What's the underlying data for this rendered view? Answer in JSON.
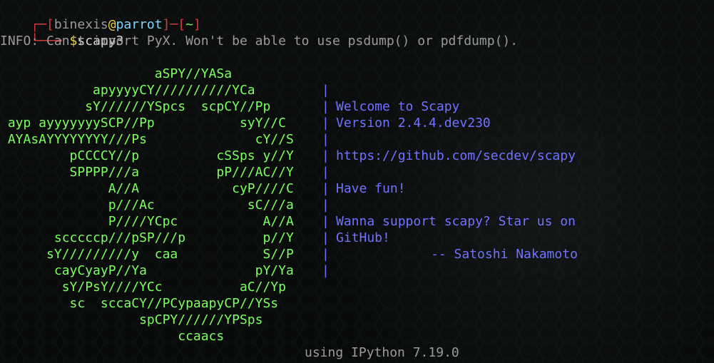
{
  "terminal": {
    "prompt": {
      "user": "binexis",
      "at": "@",
      "host": "parrot",
      "dir": "~"
    },
    "command": {
      "symbol": "$",
      "text": "scapy3"
    },
    "info": "INFO: Can't import PyX. Won't be able to use psdump() or pdfdump().",
    "art_lines": [
      "                    aSPY//YASa",
      "            apyyyyCY//////////YCa",
      "           sY//////YSpcs  scpCY//Pp",
      " ayp ayyyyyyySCP//Pp           syY//C",
      " AYAsAYYYYYYYY///Ps              cY//S",
      "         pCCCCY//p          cSSps y//Y",
      "         SPPPP///a          pP///AC//Y",
      "              A//A            cyP////C",
      "              p///Ac            sC///a",
      "              P////YCpc           A//A",
      "       scccccp///pSP///p          p//Y",
      "      sY/////////y  caa           S//P",
      "       cayCyayP//Ya              pY/Ya",
      "        sY/PsY////YCc          aC//Yp",
      "         sc  sccaCY//PCypaapyCP//YSs",
      "                  spCPY//////YPSps",
      "                       ccaacs"
    ],
    "bars": [
      "|",
      "|",
      "|",
      "|",
      "|",
      "|",
      "|",
      "|",
      "|",
      "|",
      "|",
      "|"
    ],
    "scapy_info": {
      "welcome": "Welcome to Scapy",
      "version": "Version 2.4.4.dev230",
      "url": "https://github.com/secdev/scapy",
      "fun": "Have fun!",
      "support_1": "Wanna support scapy? Star us on",
      "support_2": "GitHub!",
      "signature": "-- Satoshi Nakamoto"
    },
    "footer": "using IPython 7.19.0"
  }
}
